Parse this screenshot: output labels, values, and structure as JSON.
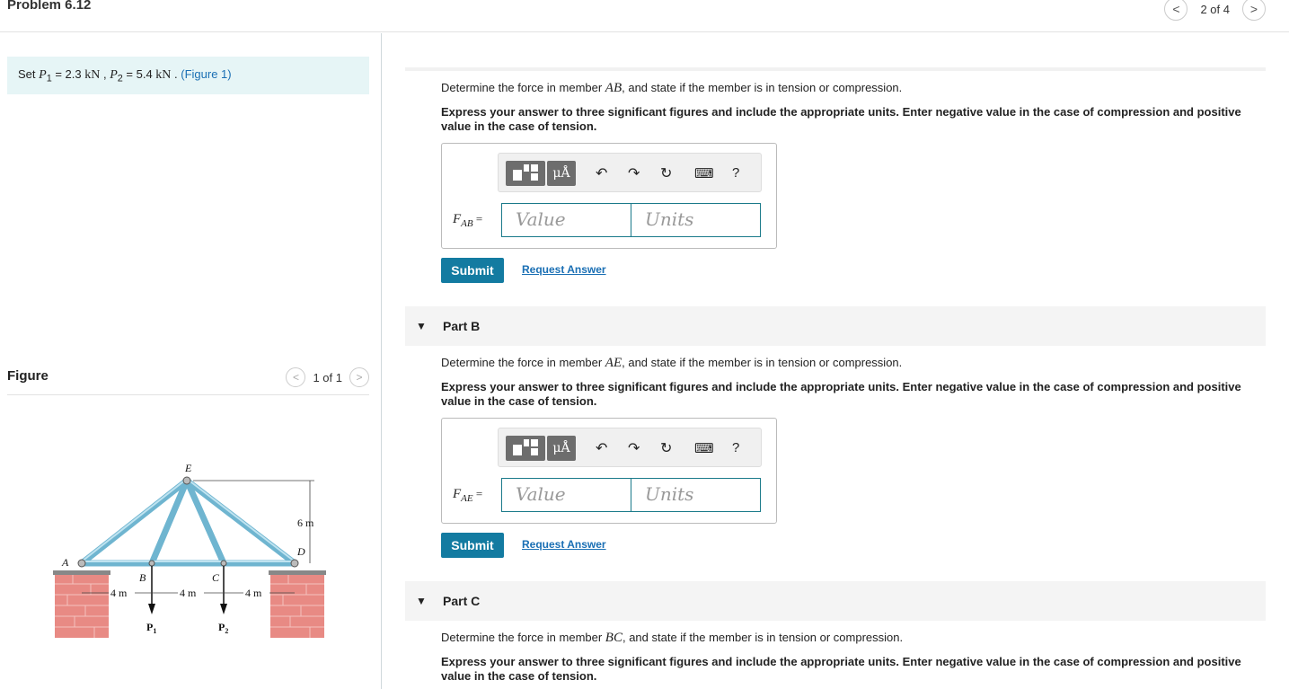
{
  "header": {
    "title": "Problem 6.12",
    "pager": {
      "prev": "<",
      "text": "2 of 4",
      "next": ">"
    }
  },
  "left": {
    "set": {
      "lead": "Set ",
      "p1_sym": "P",
      "p1_sub": "1",
      "p1_val": " = 2.3 ",
      "unit": "kN",
      "comma": " , ",
      "p2_sym": "P",
      "p2_sub": "2",
      "p2_val": " = 5.4 ",
      "dot": " . ",
      "figure_link": "(Figure 1)"
    },
    "figure": {
      "title": "Figure",
      "pager": {
        "prev": "<",
        "text": "1 of 1",
        "next": ">"
      },
      "labels": {
        "A": "A",
        "B": "B",
        "C": "C",
        "D": "D",
        "E": "E",
        "P1": "P",
        "P1sub": "1",
        "P2": "P",
        "P2sub": "2",
        "dim1": "4 m",
        "dim2": "4 m",
        "dim3": "4 m",
        "height": "6 m"
      }
    }
  },
  "parts": [
    {
      "label": "",
      "question_pre": "Determine the force in member ",
      "member": "AB",
      "question_post": ", and state if the member is in tension or compression.",
      "instructions": "Express your answer to three significant figures and include the appropriate units. Enter negative value in the case of compression and positive value in the case of tension.",
      "var": "F",
      "var_sub": "AB",
      "var_eq": " =",
      "value_placeholder": "Value",
      "units_placeholder": "Units",
      "submit": "Submit",
      "request": "Request Answer"
    },
    {
      "label": "Part B",
      "question_pre": "Determine the force in member ",
      "member": "AE",
      "question_post": ", and state if the member is in tension or compression.",
      "instructions": "Express your answer to three significant figures and include the appropriate units. Enter negative value in the case of compression and positive value in the case of tension.",
      "var": "F",
      "var_sub": "AE",
      "var_eq": " =",
      "value_placeholder": "Value",
      "units_placeholder": "Units",
      "submit": "Submit",
      "request": "Request Answer"
    },
    {
      "label": "Part C",
      "question_pre": "Determine the force in member ",
      "member": "BC",
      "question_post": ", and state if the member is in tension or compression.",
      "instructions": "Express your answer to three significant figures and include the appropriate units. Enter negative value in the case of compression and positive value in the case of tension."
    }
  ],
  "toolbar": {
    "units_btn": "μÅ",
    "help": "?",
    "icons": [
      "templates-icon",
      "units-icon",
      "undo-icon",
      "redo-icon",
      "reset-icon",
      "keyboard-icon",
      "help-icon"
    ]
  },
  "colors": {
    "accent": "#137ba1",
    "link": "#1a6fb4",
    "setbox_bg": "#e6f5f6",
    "truss": "#7ec3dc",
    "brick": "#e57a7a"
  }
}
